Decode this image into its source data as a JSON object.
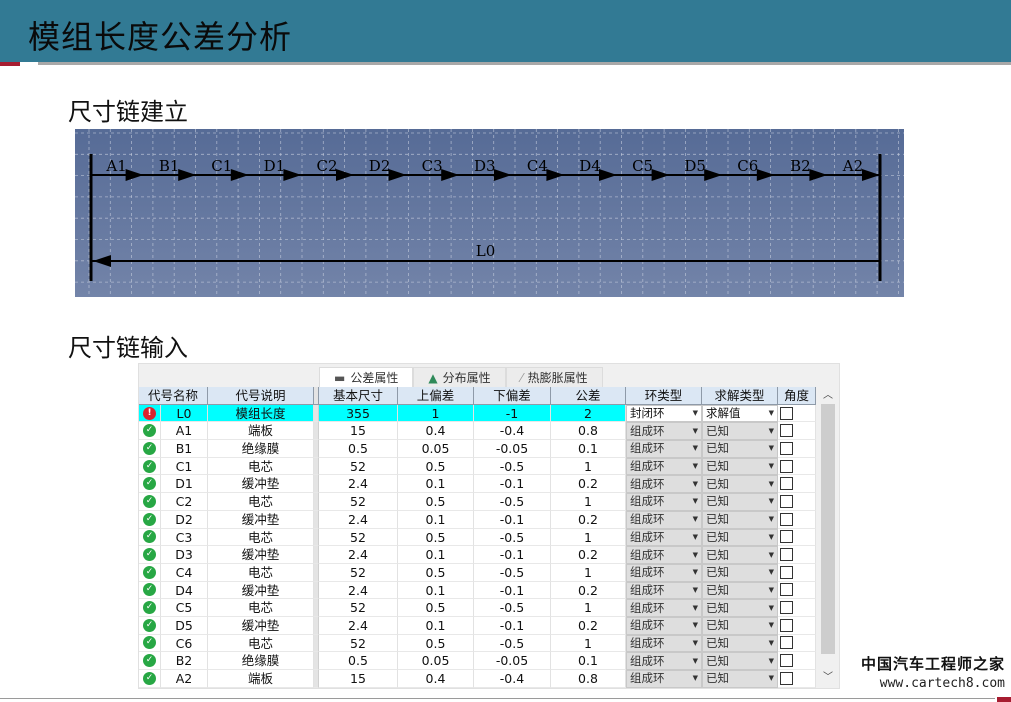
{
  "header": {
    "title": "模组长度公差分析"
  },
  "sections": {
    "chain_build": "尺寸链建立",
    "chain_input": "尺寸链输入"
  },
  "diagram": {
    "components": [
      "A1",
      "B1",
      "C1",
      "D1",
      "C2",
      "D2",
      "C3",
      "D3",
      "C4",
      "D4",
      "C5",
      "D5",
      "C6",
      "B2",
      "A2"
    ],
    "closing_link": "L0",
    "background_top": "#566b96",
    "background_bottom": "#7384a9"
  },
  "tabs": [
    {
      "label": "公差属性",
      "icon": "ruler-icon",
      "active": true
    },
    {
      "label": "分布属性",
      "icon": "distribution-icon",
      "active": false
    },
    {
      "label": "热膨胀属性",
      "icon": "thermal-icon",
      "active": false
    }
  ],
  "table": {
    "headers": {
      "name": "代号名称",
      "desc": "代号说明",
      "base": "基本尺寸",
      "upper": "上偏差",
      "lower": "下偏差",
      "tol": "公差",
      "ring": "环类型",
      "solve": "求解类型",
      "angle": "角度"
    },
    "rows": [
      {
        "status": "error",
        "name": "L0",
        "desc": "模组长度",
        "base": "355",
        "upper": "1",
        "lower": "-1",
        "tol": "2",
        "ring": "封闭环",
        "solve": "求解值",
        "angle": false
      },
      {
        "status": "ok",
        "name": "A1",
        "desc": "端板",
        "base": "15",
        "upper": "0.4",
        "lower": "-0.4",
        "tol": "0.8",
        "ring": "组成环",
        "solve": "已知",
        "angle": false
      },
      {
        "status": "ok",
        "name": "B1",
        "desc": "绝缘膜",
        "base": "0.5",
        "upper": "0.05",
        "lower": "-0.05",
        "tol": "0.1",
        "ring": "组成环",
        "solve": "已知",
        "angle": false
      },
      {
        "status": "ok",
        "name": "C1",
        "desc": "电芯",
        "base": "52",
        "upper": "0.5",
        "lower": "-0.5",
        "tol": "1",
        "ring": "组成环",
        "solve": "已知",
        "angle": false
      },
      {
        "status": "ok",
        "name": "D1",
        "desc": "缓冲垫",
        "base": "2.4",
        "upper": "0.1",
        "lower": "-0.1",
        "tol": "0.2",
        "ring": "组成环",
        "solve": "已知",
        "angle": false
      },
      {
        "status": "ok",
        "name": "C2",
        "desc": "电芯",
        "base": "52",
        "upper": "0.5",
        "lower": "-0.5",
        "tol": "1",
        "ring": "组成环",
        "solve": "已知",
        "angle": false
      },
      {
        "status": "ok",
        "name": "D2",
        "desc": "缓冲垫",
        "base": "2.4",
        "upper": "0.1",
        "lower": "-0.1",
        "tol": "0.2",
        "ring": "组成环",
        "solve": "已知",
        "angle": false
      },
      {
        "status": "ok",
        "name": "C3",
        "desc": "电芯",
        "base": "52",
        "upper": "0.5",
        "lower": "-0.5",
        "tol": "1",
        "ring": "组成环",
        "solve": "已知",
        "angle": false
      },
      {
        "status": "ok",
        "name": "D3",
        "desc": "缓冲垫",
        "base": "2.4",
        "upper": "0.1",
        "lower": "-0.1",
        "tol": "0.2",
        "ring": "组成环",
        "solve": "已知",
        "angle": false
      },
      {
        "status": "ok",
        "name": "C4",
        "desc": "电芯",
        "base": "52",
        "upper": "0.5",
        "lower": "-0.5",
        "tol": "1",
        "ring": "组成环",
        "solve": "已知",
        "angle": false
      },
      {
        "status": "ok",
        "name": "D4",
        "desc": "缓冲垫",
        "base": "2.4",
        "upper": "0.1",
        "lower": "-0.1",
        "tol": "0.2",
        "ring": "组成环",
        "solve": "已知",
        "angle": false
      },
      {
        "status": "ok",
        "name": "C5",
        "desc": "电芯",
        "base": "52",
        "upper": "0.5",
        "lower": "-0.5",
        "tol": "1",
        "ring": "组成环",
        "solve": "已知",
        "angle": false
      },
      {
        "status": "ok",
        "name": "D5",
        "desc": "缓冲垫",
        "base": "2.4",
        "upper": "0.1",
        "lower": "-0.1",
        "tol": "0.2",
        "ring": "组成环",
        "solve": "已知",
        "angle": false
      },
      {
        "status": "ok",
        "name": "C6",
        "desc": "电芯",
        "base": "52",
        "upper": "0.5",
        "lower": "-0.5",
        "tol": "1",
        "ring": "组成环",
        "solve": "已知",
        "angle": false
      },
      {
        "status": "ok",
        "name": "B2",
        "desc": "绝缘膜",
        "base": "0.5",
        "upper": "0.05",
        "lower": "-0.05",
        "tol": "0.1",
        "ring": "组成环",
        "solve": "已知",
        "angle": false
      },
      {
        "status": "ok",
        "name": "A2",
        "desc": "端板",
        "base": "15",
        "upper": "0.4",
        "lower": "-0.4",
        "tol": "0.8",
        "ring": "组成环",
        "solve": "已知",
        "angle": false
      }
    ],
    "highlight_color": "#00ffff"
  },
  "watermark": {
    "cn": "中国汽车工程师之家",
    "url": "www.cartech8.com"
  },
  "colors": {
    "header_bg": "#327a94",
    "accent_red": "#a71d31",
    "status_ok": "#27a744",
    "status_error": "#d9232f"
  }
}
